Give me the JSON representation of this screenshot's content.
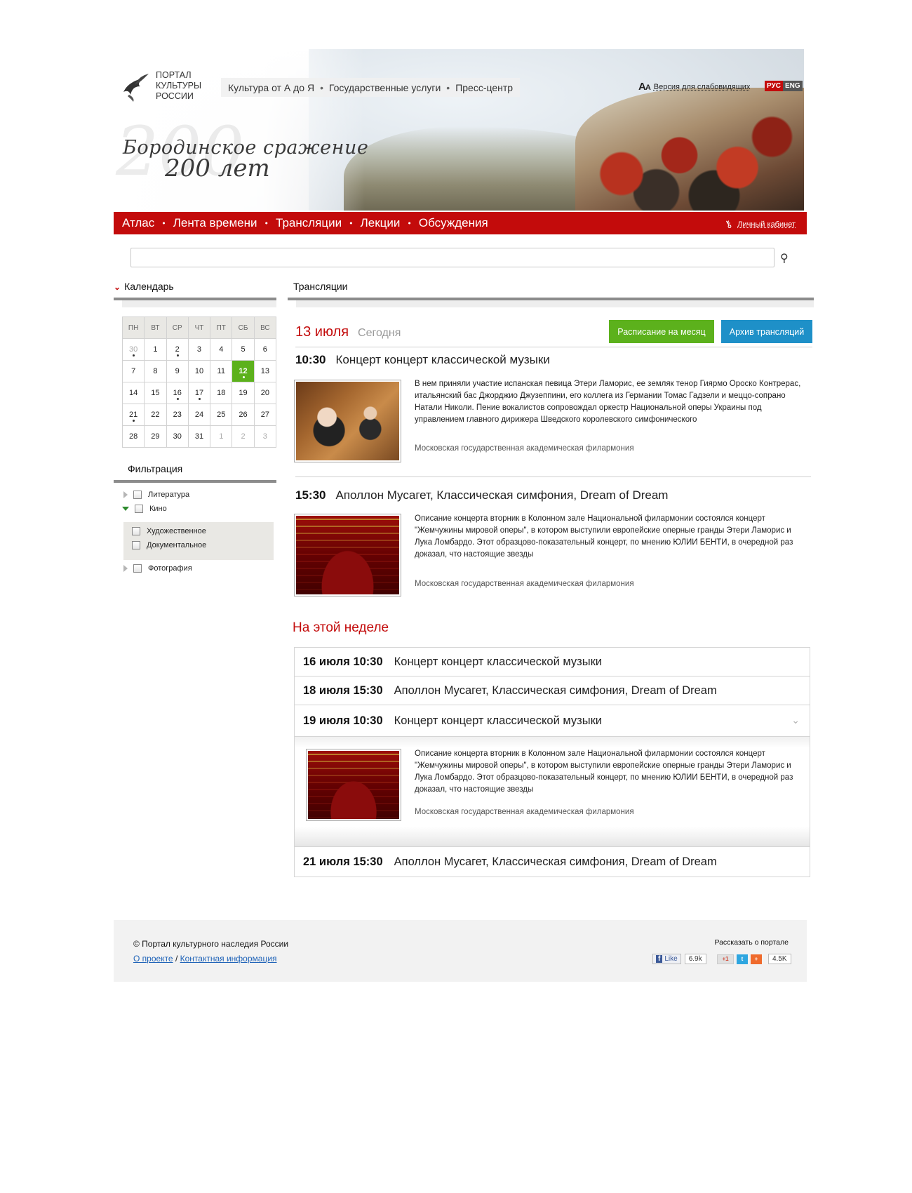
{
  "header": {
    "logo_lines": [
      "ПОРТАЛ",
      "КУЛЬТУРЫ",
      "РОССИИ"
    ],
    "top_nav": [
      "Культура от А до Я",
      "Государственные услуги",
      "Пресс-центр"
    ],
    "accessibility": {
      "aa": "А",
      "aa_small": "А",
      "label": "Версия для слабовидящих"
    },
    "languages": [
      "РУС",
      "ENG"
    ],
    "hero_title_line1": "Бородинское сражение",
    "hero_title_line2": "200 лет",
    "hero_ghost": "200"
  },
  "main_nav": {
    "items": [
      "Атлас",
      "Лента времени",
      "Трансляции",
      "Лекции",
      "Обсуждения"
    ],
    "cabinet": "Личный кабинет"
  },
  "search": {
    "placeholder": "",
    "value": ""
  },
  "sidebar": {
    "calendar_title": "Календарь",
    "weekdays": [
      "ПН",
      "ВТ",
      "СР",
      "ЧТ",
      "ПТ",
      "СБ",
      "ВС"
    ],
    "weeks": [
      [
        "30",
        "1",
        "2",
        "3",
        "4",
        "5",
        "6"
      ],
      [
        "7",
        "8",
        "9",
        "10",
        "11",
        "12",
        "13"
      ],
      [
        "14",
        "15",
        "16",
        "17",
        "18",
        "19",
        "20"
      ],
      [
        "21",
        "22",
        "23",
        "24",
        "25",
        "26",
        "27"
      ],
      [
        "28",
        "29",
        "30",
        "31",
        "1",
        "2",
        "3"
      ]
    ],
    "filter_title": "Фильтрация",
    "filters": {
      "literature": "Литература",
      "cinema": "Кино",
      "fiction": "Художественное",
      "documentary": "Документальное",
      "photo": "Фотография"
    }
  },
  "main": {
    "section_title": "Трансляции",
    "date": "13 июля",
    "today_label": "Сегодня",
    "btn_schedule": "Расписание  на месяц",
    "btn_archive": "Архив трансляций",
    "events": [
      {
        "time": "10:30",
        "title": "Концерт концерт классической музыки",
        "desc": "В нем приняли участие испанская певица Этери Ламорис, ее земляк тенор Гиярмо Ороско Контрерас, итальянский бас Джорджио Джузеппини, его коллега из Германии Томас Гадзели и меццо-сопрано Натали Николи. Пение вокалистов сопровождал оркестр Национальной оперы Украины под управлением главного дирижера Шведского королевского симфонического",
        "venue": "Московская государственная академическая филармония"
      },
      {
        "time": "15:30",
        "title": "Аполлон Мусагет, Классическая симфония, Dream of Dream",
        "desc": "Описание концерта  вторник в Колонном зале Национальной филармонии состоялся концерт \"Жемчужины мировой оперы\", в котором выступили европейские оперные гранды Этери Ламорис и Лука Ломбардо. Этот образцово-показательный концерт, по мнению ЮЛИИ БЕНТИ, в очередной раз доказал, что настоящие звезды",
        "venue": "Московская государственная академическая филармония"
      }
    ],
    "week_title": "На этой неделе",
    "week": [
      {
        "date": "16 июля 10:30",
        "title": "Концерт концерт классической музыки"
      },
      {
        "date": "18 июля 15:30",
        "title": "Аполлон Мусагет, Классическая симфония, Dream of Dream"
      },
      {
        "date": "19 июля 10:30",
        "title": "Концерт концерт классической музыки"
      },
      {
        "date": "21 июля 15:30",
        "title": "Аполлон Мусагет, Классическая симфония, Dream of Dream"
      }
    ],
    "week_expanded": {
      "desc": "Описание концерта  вторник в Колонном зале Национальной филармонии состоялся концерт \"Жемчужины мировой оперы\", в котором выступили европейские оперные гранды Этери Ламорис и Лука Ломбардо. Этот образцово-показательный концерт, по мнению ЮЛИИ БЕНТИ, в очередной раз доказал, что настоящие звезды",
      "venue": "Московская государственная академическая филармония"
    }
  },
  "footer": {
    "copyright": "© Портал культурного наследия России",
    "about": "О проекте",
    "separator": " / ",
    "contacts": "Контактная информация",
    "share_label": "Рассказать о портале",
    "fb_like": "Like",
    "fb_count": "6.9k",
    "gplus": "+1",
    "share_count": "4.5K"
  },
  "colors": {
    "brand_red": "#c30b0b",
    "green": "#5cb11c",
    "blue": "#1e90c8"
  }
}
